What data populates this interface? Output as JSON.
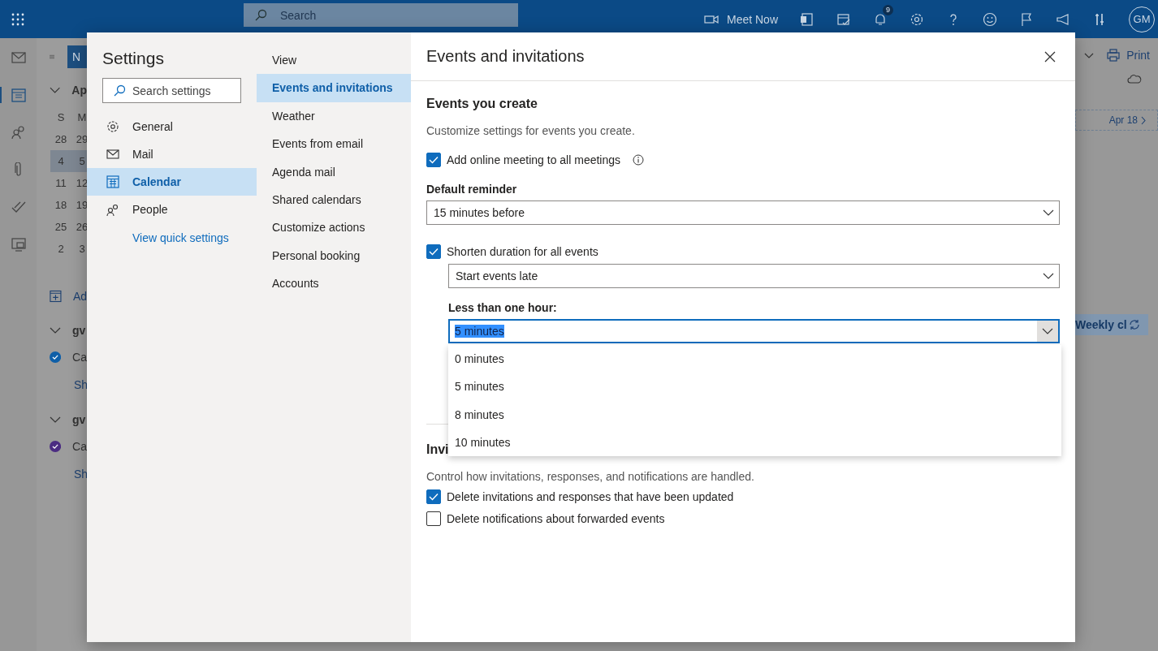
{
  "top_bar": {
    "search_placeholder": "Search",
    "meet_now": "Meet Now",
    "notification_count": "9",
    "avatar": "GM"
  },
  "rail": [
    {
      "kind": "mail",
      "selected": false
    },
    {
      "kind": "calendar",
      "selected": true
    },
    {
      "kind": "people",
      "selected": false
    },
    {
      "kind": "attach",
      "selected": false
    },
    {
      "kind": "todo",
      "selected": false
    },
    {
      "kind": "board",
      "selected": false
    }
  ],
  "calendar_pane": {
    "new_event": "N",
    "month": "Ap",
    "weekdays": [
      "S",
      "M"
    ],
    "weeks": [
      {
        "days": [
          "28",
          "29"
        ],
        "selected": false
      },
      {
        "days": [
          "4",
          "5"
        ],
        "selected": true
      },
      {
        "days": [
          "11",
          "12"
        ],
        "selected": false
      },
      {
        "days": [
          "18",
          "19"
        ],
        "selected": false
      },
      {
        "days": [
          "25",
          "26"
        ],
        "selected": false
      },
      {
        "days": [
          "2",
          "3"
        ],
        "selected": false
      }
    ],
    "add_calendar": "Ad",
    "groups": [
      {
        "name": "gv",
        "calendar": "Ca",
        "color": "#0f5fa8",
        "show": "Sh"
      },
      {
        "name": "gv",
        "calendar": "Ca",
        "color": "#4b2c82",
        "show": "Sh"
      }
    ]
  },
  "right_pane": {
    "print": "Print",
    "date": "Apr 18",
    "event": "Weekly cl"
  },
  "settings": {
    "title": "Settings",
    "search_placeholder": "Search settings",
    "categories": [
      {
        "label": "General",
        "kind": "gear",
        "selected": false
      },
      {
        "label": "Mail",
        "kind": "mail",
        "selected": false
      },
      {
        "label": "Calendar",
        "kind": "calendar",
        "selected": true
      },
      {
        "label": "People",
        "kind": "people",
        "selected": false
      }
    ],
    "quick_link": "View quick settings",
    "subnav": [
      {
        "label": "View",
        "selected": false
      },
      {
        "label": "Events and invitations",
        "selected": true
      },
      {
        "label": "Weather",
        "selected": false
      },
      {
        "label": "Events from email",
        "selected": false
      },
      {
        "label": "Agenda mail",
        "selected": false
      },
      {
        "label": "Shared calendars",
        "selected": false
      },
      {
        "label": "Customize actions",
        "selected": false
      },
      {
        "label": "Personal booking",
        "selected": false
      },
      {
        "label": "Accounts",
        "selected": false
      }
    ],
    "panel": {
      "title": "Events and invitations",
      "create": {
        "heading": "Events you create",
        "description": "Customize settings for events you create.",
        "online_meeting": {
          "label": "Add online meeting to all meetings",
          "checked": true
        },
        "reminder_label": "Default reminder",
        "reminder": "15 minutes before",
        "shorten": {
          "label": "Shorten duration for all events",
          "checked": true
        },
        "shorten_mode": "Start events late",
        "short_label": "Less than one hour:",
        "short_value": "5 minutes",
        "short_options": [
          "0 minutes",
          "5 minutes",
          "8 minutes",
          "10 minutes"
        ]
      },
      "invitations": {
        "heading": "Invi",
        "description": "Control how invitations, responses, and notifications are handled.",
        "options": [
          {
            "label": "Delete invitations and responses that have been updated",
            "checked": true
          },
          {
            "label": "Delete notifications about forwarded events",
            "checked": false
          }
        ]
      }
    }
  }
}
